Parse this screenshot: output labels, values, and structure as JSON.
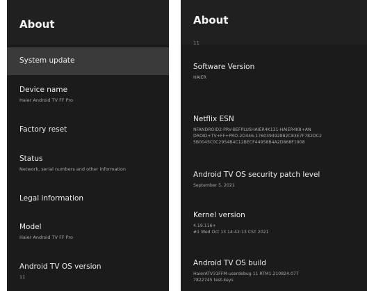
{
  "left_panel": {
    "title": "About",
    "items": [
      {
        "title": "System update",
        "subtitle": ""
      },
      {
        "title": "Device name",
        "subtitle": "Haier Android TV FF Pro"
      },
      {
        "title": "Factory reset",
        "subtitle": ""
      },
      {
        "title": "Status",
        "subtitle": "Network, serial numbers and other information"
      },
      {
        "title": "Legal information",
        "subtitle": ""
      },
      {
        "title": "Model",
        "subtitle": "Haier Android TV FF Pro"
      },
      {
        "title": "Android TV OS version",
        "subtitle": "11"
      }
    ]
  },
  "right_panel": {
    "title": "About",
    "scroll_hint": "11",
    "items": [
      {
        "title": "Software Version",
        "lines": [
          "HAIER"
        ]
      },
      {
        "title": "Netflix ESN",
        "lines": [
          "NFANDROID2-PRV-BEFPLUSHAIER4K131-HAIER4K8+AN",
          "DROID+TV+FF+PRO-2D446-176039492882C83E7F782DC2",
          "5B0045C0C2954B4C12BECF44958B4A2D868F1908"
        ]
      },
      {
        "title": "Android TV OS security patch level",
        "lines": [
          "September 5, 2021"
        ]
      },
      {
        "title": "Kernel version",
        "lines": [
          "4.19.116+",
          "#1 Wed Oct 13 14:42:13 CST 2021"
        ]
      },
      {
        "title": "Android TV OS build",
        "lines": [
          "HaierATV31FFM-userdebug 11 RTM1.210824.077",
          "7822745 test-keys"
        ]
      }
    ]
  }
}
